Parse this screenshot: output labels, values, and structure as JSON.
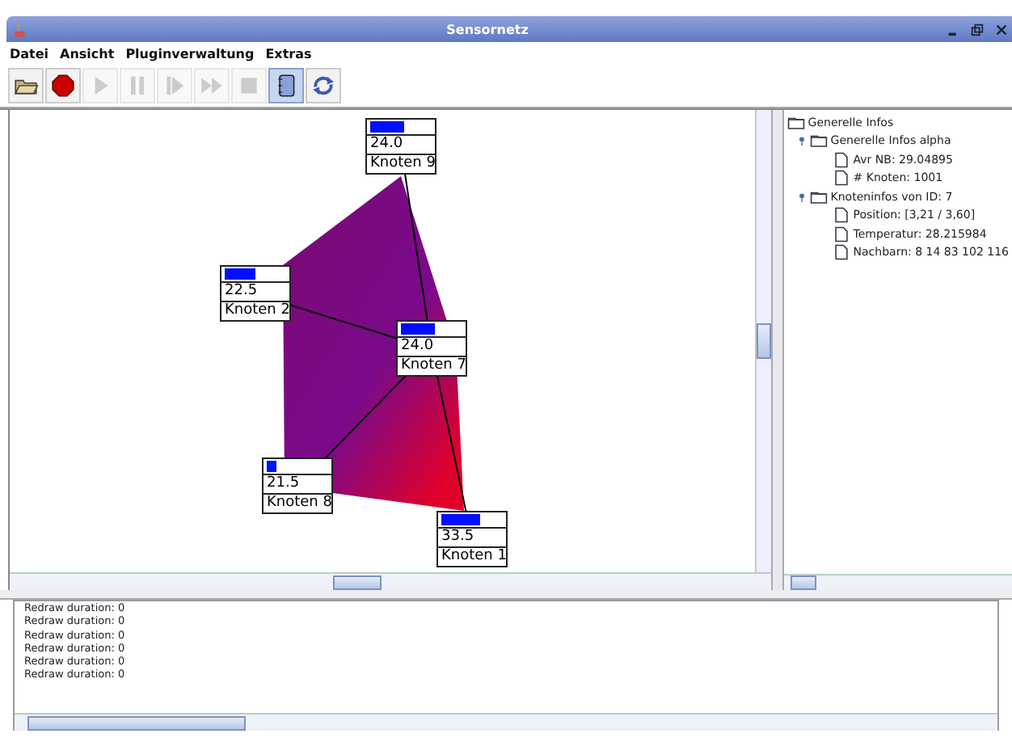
{
  "window": {
    "title": "Sensornetz"
  },
  "menu": [
    {
      "label": "Datei"
    },
    {
      "label": "Ansicht"
    },
    {
      "label": "Pluginverwaltung"
    },
    {
      "label": "Extras"
    }
  ],
  "toolbar": [
    {
      "kind": "open",
      "disabled": false,
      "selected": false
    },
    {
      "kind": "record",
      "disabled": false,
      "selected": false
    },
    {
      "kind": "play",
      "disabled": true,
      "selected": false
    },
    {
      "kind": "pause",
      "disabled": true,
      "selected": false
    },
    {
      "kind": "step",
      "disabled": true,
      "selected": false
    },
    {
      "kind": "forward",
      "disabled": true,
      "selected": false
    },
    {
      "kind": "stop",
      "disabled": true,
      "selected": false
    },
    {
      "kind": "log",
      "disabled": false,
      "selected": true
    },
    {
      "kind": "refresh",
      "disabled": false,
      "selected": false
    }
  ],
  "nodes": [
    {
      "name": "Knoten 9",
      "value": "24.0",
      "level": 0.55
    },
    {
      "name": "Knoten 2",
      "value": "22.5",
      "level": 0.5
    },
    {
      "name": "Knoten 7",
      "value": "24.0",
      "level": 0.55
    },
    {
      "name": "Knoten 8",
      "value": "21.5",
      "level": 0.15
    },
    {
      "name": "Knoten 1",
      "value": "33.5",
      "level": 0.62
    }
  ],
  "tree": {
    "label": "Generelle Infos",
    "expanded": true,
    "children": [
      {
        "label": "Generelle Infos alpha",
        "expanded": true,
        "children": [
          {
            "label": "Avr NB: 29.04895"
          },
          {
            "label": "# Knoten: 1001"
          }
        ]
      },
      {
        "label": "Knoteninfos von ID: 7",
        "expanded": true,
        "children": [
          {
            "label": "Position: [3,21 / 3,60]"
          },
          {
            "label": "Temperatur: 28.215984"
          },
          {
            "label": "Nachbarn: 8 14 83 102 116"
          }
        ]
      }
    ]
  },
  "log": [
    "Redraw duration: 0",
    "Redraw duration: 0",
    "Redraw duration: 0",
    "Redraw duration: 0",
    "Redraw duration: 0",
    "Redraw duration: 0"
  ]
}
